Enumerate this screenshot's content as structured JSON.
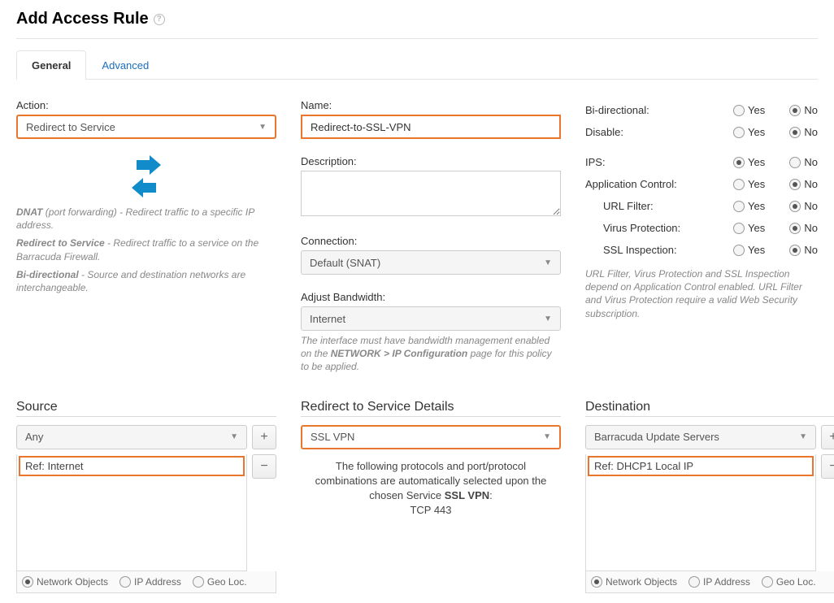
{
  "page": {
    "title": "Add Access Rule"
  },
  "tabs": {
    "general": "General",
    "advanced": "Advanced"
  },
  "action": {
    "label": "Action:",
    "value": "Redirect to Service",
    "help": {
      "dnat_b": "DNAT",
      "dnat_r": " (port forwarding) - Redirect traffic to a specific IP address.",
      "rts_b": "Redirect to Service",
      "rts_r": " - Redirect traffic to a service on the Barracuda Firewall.",
      "bidi_b": "Bi-directional",
      "bidi_r": " - Source and destination networks are interchangeable."
    }
  },
  "name": {
    "label": "Name:",
    "value": "Redirect-to-SSL-VPN"
  },
  "description": {
    "label": "Description:",
    "value": ""
  },
  "connection": {
    "label": "Connection:",
    "value": "Default (SNAT)"
  },
  "bandwidth": {
    "label": "Adjust Bandwidth:",
    "value": "Internet",
    "help_pre": "The interface must have bandwidth management enabled on the ",
    "help_bold": "NETWORK > IP Configuration",
    "help_post": " page for this policy to be applied."
  },
  "toggles": {
    "yes": "Yes",
    "no": "No",
    "bi": {
      "label": "Bi-directional:",
      "value": "No"
    },
    "disable": {
      "label": "Disable:",
      "value": "No"
    },
    "ips": {
      "label": "IPS:",
      "value": "Yes"
    },
    "appctrl": {
      "label": "Application Control:",
      "value": "No"
    },
    "urlfilter": {
      "label": "URL Filter:",
      "value": "No"
    },
    "virus": {
      "label": "Virus Protection:",
      "value": "No"
    },
    "sslinspect": {
      "label": "SSL Inspection:",
      "value": "No"
    },
    "help": "URL Filter, Virus Protection and SSL Inspection depend on Application Control enabled. URL Filter and Virus Protection require a valid Web Security subscription."
  },
  "source": {
    "title": "Source",
    "dropdown": "Any",
    "item": "Ref: Internet",
    "footer": {
      "opt1": "Network Objects",
      "opt2": "IP Address",
      "opt3": "Geo Loc."
    }
  },
  "details": {
    "title": "Redirect to Service Details",
    "dropdown": "SSL VPN",
    "text_pre": "The following protocols and port/protocol combinations are automatically selected upon the chosen Service ",
    "text_bold": "SSL VPN",
    "text_post": ":",
    "proto": "TCP 443"
  },
  "destination": {
    "title": "Destination",
    "dropdown": "Barracuda Update Servers",
    "item": "Ref: DHCP1 Local IP",
    "footer": {
      "opt1": "Network Objects",
      "opt2": "IP Address",
      "opt3": "Geo Loc."
    }
  }
}
